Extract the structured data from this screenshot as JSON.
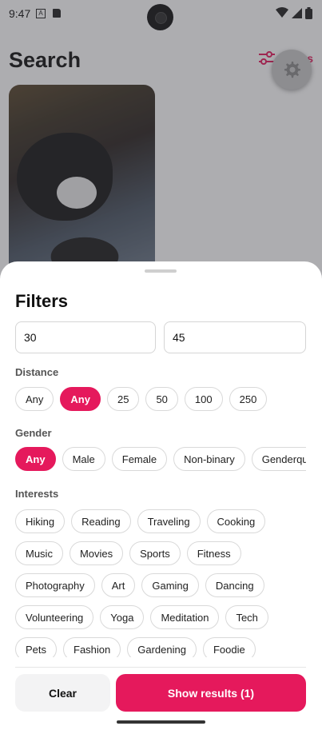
{
  "status": {
    "time": "9:47",
    "a_icon": "A"
  },
  "app": {
    "title": "Search",
    "filters_label": "Filters"
  },
  "sheet": {
    "title": "Filters",
    "age_min": "30",
    "age_max": "45",
    "distance_label": "Distance",
    "distance_options": [
      "Any",
      "Any",
      "25",
      "50",
      "100",
      "250"
    ],
    "distance_selected_index": 1,
    "gender_label": "Gender",
    "gender_options": [
      "Any",
      "Male",
      "Female",
      "Non-binary",
      "Genderqu"
    ],
    "gender_selected_index": 0,
    "interests_label": "Interests",
    "interests_rows": [
      [
        "Hiking",
        "Reading",
        "Traveling",
        "Cooking"
      ],
      [
        "Music",
        "Movies",
        "Sports",
        "Fitness"
      ],
      [
        "Photography",
        "Art",
        "Gaming",
        "Dancing"
      ],
      [
        "Volunteering",
        "Yoga",
        "Meditation",
        "Tech"
      ],
      [
        "Pets",
        "Fashion",
        "Gardening",
        "Foodie"
      ]
    ],
    "clear_label": "Clear",
    "show_results_label": "Show results (1)"
  },
  "colors": {
    "accent": "#e5195c",
    "scrim": "#3c3c42"
  },
  "icons": {
    "filters": "sliders-icon",
    "fab": "gear-icon"
  }
}
